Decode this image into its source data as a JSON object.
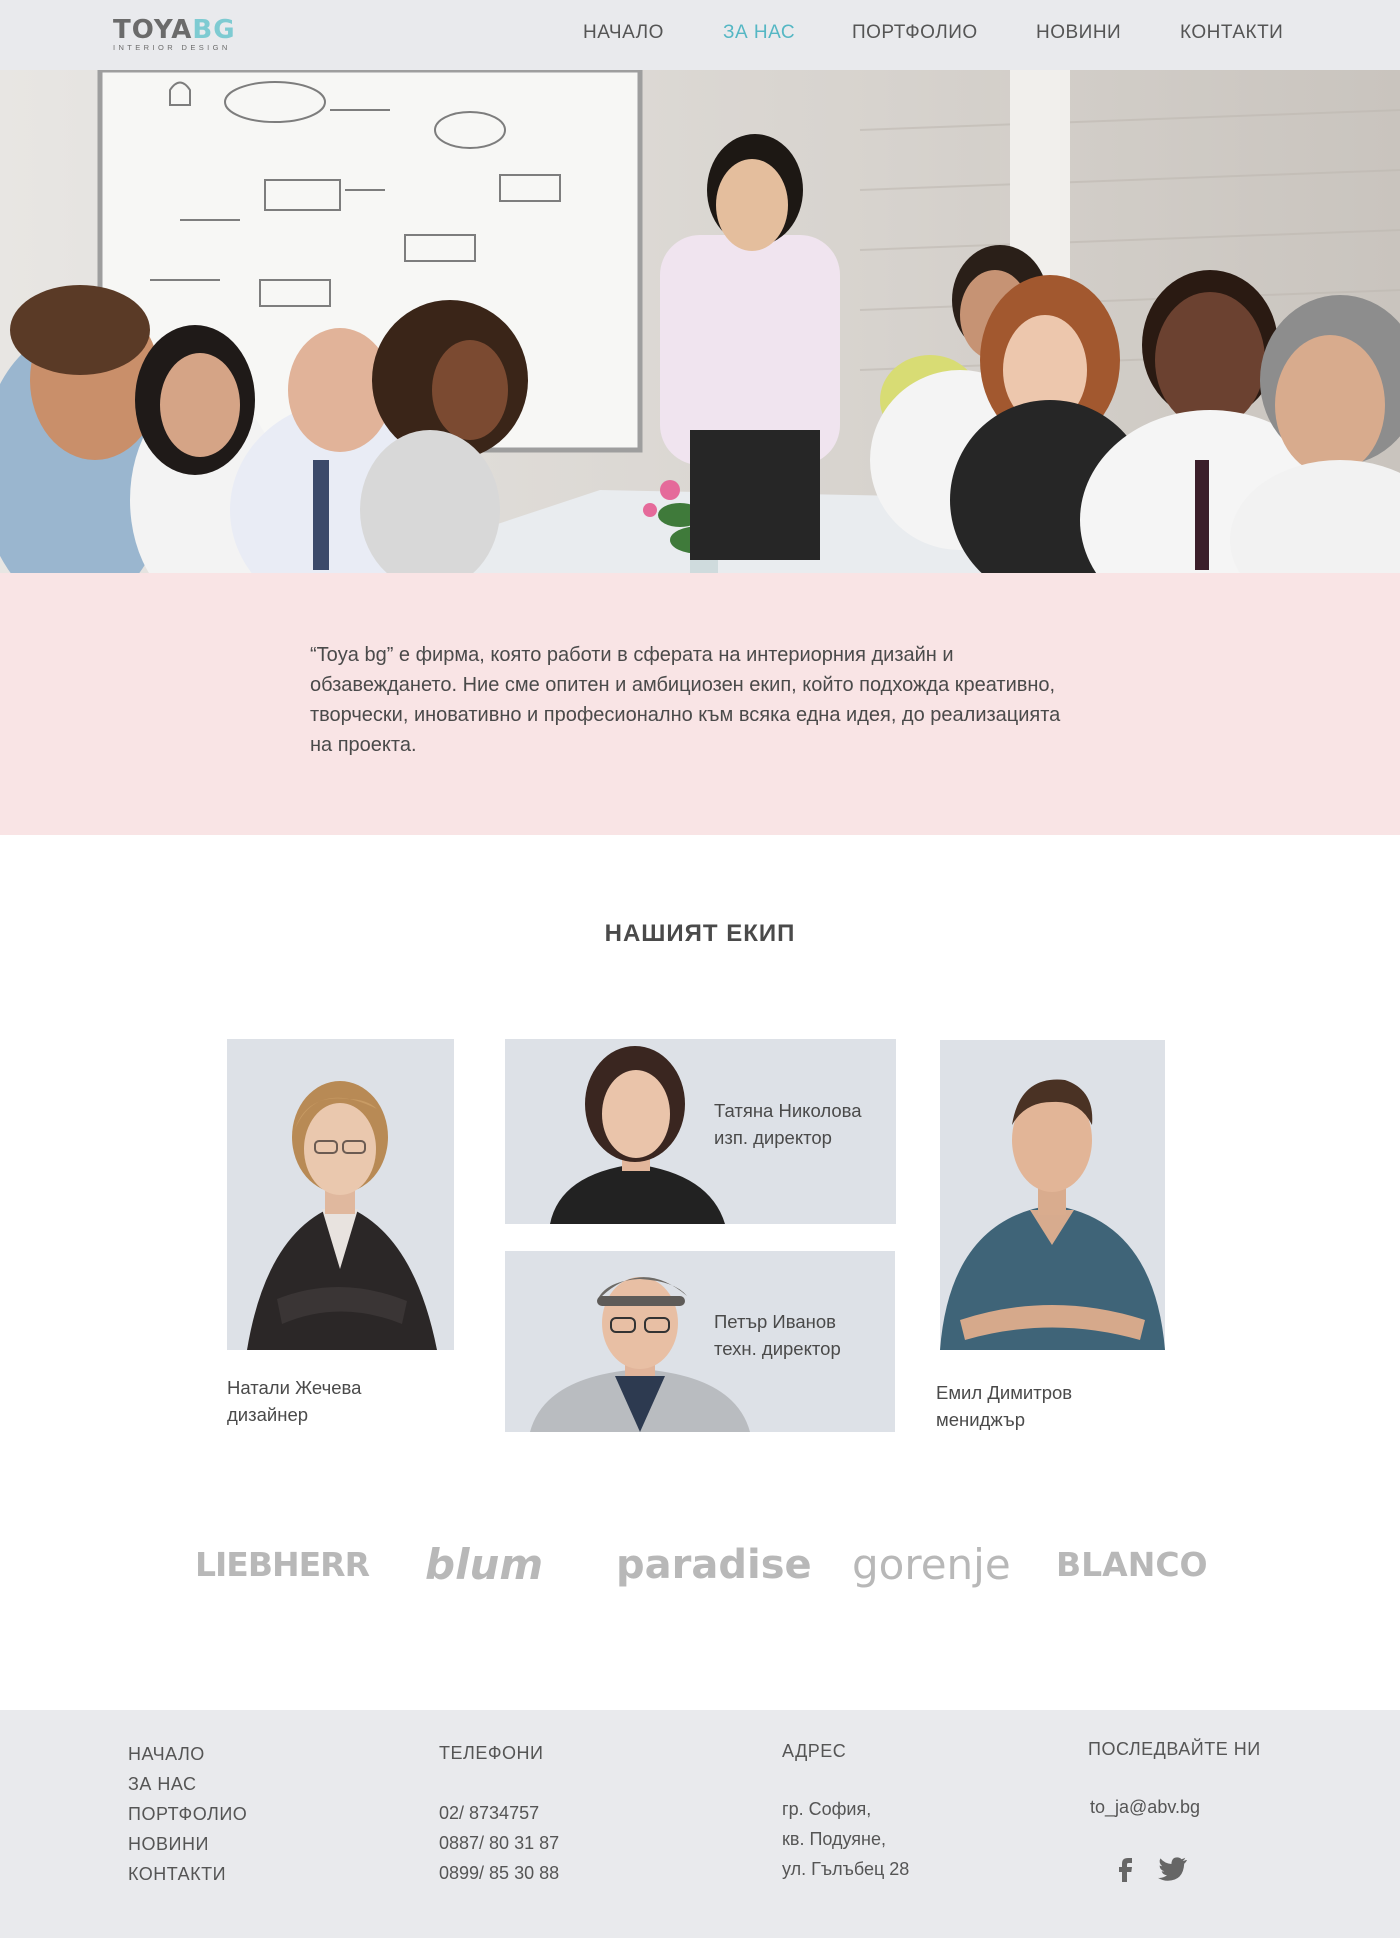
{
  "header": {
    "logo": {
      "main_a": "TOYA",
      "main_b": "BG",
      "sub": "INTERIOR DESIGN"
    },
    "nav": [
      {
        "label": "НАЧАЛО",
        "active": false
      },
      {
        "label": "ЗА НАС",
        "active": true
      },
      {
        "label": "ПОРТФОЛИО",
        "active": false
      },
      {
        "label": "НОВИНИ",
        "active": false
      },
      {
        "label": "КОНТАКТИ",
        "active": false
      }
    ]
  },
  "intro": {
    "text": "“Toya bg” е фирма, която работи в сферата на интериорния дизайн и обзавеждането. Ние сме опитен и амбициозен екип, който подхожда креативно, творчески, иновативно и професионално към всяка една идея, до реализацията на проекта."
  },
  "team": {
    "title": "НАШИЯТ ЕКИП",
    "members": [
      {
        "name": "Натали Жечева",
        "role": "дизайнер"
      },
      {
        "name": "Татяна Николова",
        "role": "изп. директор"
      },
      {
        "name": "Петър Иванов",
        "role": "техн. директор"
      },
      {
        "name": "Емил Димитров",
        "role": "мениджър"
      }
    ]
  },
  "brands": [
    "LIEBHERR",
    "blum",
    "paradise",
    "gorenje",
    "BLANCO"
  ],
  "footer": {
    "links": [
      "НАЧАЛО",
      "ЗА НАС",
      "ПОРТФОЛИО",
      "НОВИНИ",
      "КОНТАКТИ"
    ],
    "phones": {
      "title": "ТЕЛЕФОНИ",
      "items": [
        "02/ 8734757",
        "0887/ 80 31 87",
        "0899/ 85 30 88"
      ]
    },
    "address": {
      "title": "АДРЕС",
      "lines": [
        "гр. София,",
        "кв. Подуяне,",
        "ул. Гълъбец 28"
      ]
    },
    "follow": {
      "title": "ПОСЛЕДВАЙТЕ НИ",
      "email": "to_ja@abv.bg",
      "icons": [
        "facebook-icon",
        "twitter-icon"
      ]
    }
  },
  "colors": {
    "accent": "#55b7c4",
    "header_bg": "#e9eaed",
    "intro_bg": "#f9e4e5",
    "text": "#4a4a4a",
    "photo_bg": "#dde1e7",
    "brand_gray": "#b8b8b8"
  }
}
